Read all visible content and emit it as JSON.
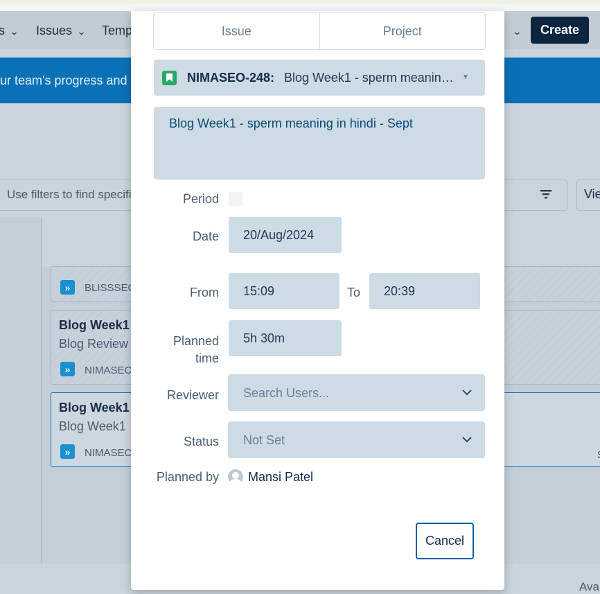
{
  "nav": {
    "items": [
      "s",
      "Issues",
      "Temp"
    ],
    "create_label": "Create"
  },
  "banner": {
    "text": "ur team's progress and"
  },
  "filter": {
    "placeholder": "Use filters to find specifi",
    "view_label": "Vie"
  },
  "board": {
    "cards": [
      {
        "key": "BLISSSEO"
      },
      {
        "title": "Blog Week1",
        "subtitle": "Blog Review",
        "key": "NIMASEO"
      },
      {
        "title": "Blog Week1",
        "subtitle": "Blog Week1",
        "key": "NIMASEO"
      }
    ],
    "footer_text": "Ava",
    "side_char": "S"
  },
  "modal": {
    "tabs": [
      "Issue",
      "Project"
    ],
    "issue": {
      "key": "NIMASEO-248:",
      "summary": "Blog Week1 - sperm meaning in hindi - Sept"
    },
    "description": "Blog Week1 - sperm meaning in hindi - Sept",
    "labels": {
      "period": "Period",
      "date": "Date",
      "from": "From",
      "to": "To",
      "planned_time": "Planned time",
      "reviewer": "Reviewer",
      "status": "Status",
      "planned_by": "Planned by"
    },
    "values": {
      "date": "20/Aug/2024",
      "from": "15:09",
      "to": "20:39",
      "planned_time": "5h 30m"
    },
    "reviewer_placeholder": "Search Users...",
    "status_value": "Not Set",
    "planner_name": "Mansi Patel",
    "cancel_label": "Cancel"
  },
  "colors": {
    "accent": "#0c5fa7",
    "create_button": "#0e2540",
    "banner": "#0b71b6",
    "issue_icon": "#27a965"
  }
}
